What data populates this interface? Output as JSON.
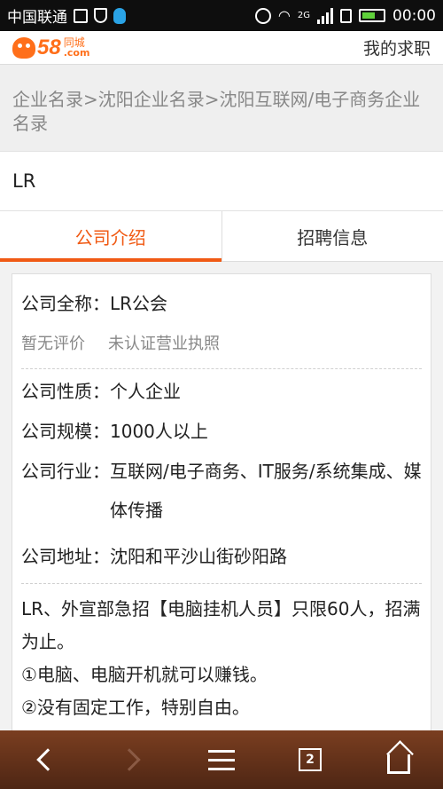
{
  "status_bar": {
    "carrier": "中国联通",
    "network": "2G",
    "time": "00:00"
  },
  "header": {
    "logo_number": "58",
    "logo_cn": "同城",
    "logo_domain": ".com",
    "my_job_label": "我的求职"
  },
  "breadcrumb": {
    "text": "企业名录>沈阳企业名录>沈阳互联网/电子商务企业名录"
  },
  "company": {
    "short_name": "LR"
  },
  "tabs": [
    {
      "label": "公司介绍",
      "active": true
    },
    {
      "label": "招聘信息",
      "active": false
    }
  ],
  "profile": {
    "fullname_key": "公司全称：",
    "fullname_value": "LR公会",
    "rating": "暂无评价",
    "license": "未认证营业执照",
    "nature_key": "公司性质：",
    "nature_value": "个人企业",
    "scale_key": "公司规模：",
    "scale_value": "1000人以上",
    "industry_key": "公司行业：",
    "industry_value": "互联网/电子商务、IT服务/系统集成、媒体传播",
    "address_key": "公司地址：",
    "address_value": "沈阳和平沙山街砂阳路"
  },
  "description": [
    "LR、外宣部急招【电脑挂机人员】只限60人，招满为止。",
    "①电脑、电脑开机就可以赚钱。",
    "②没有固定工作，特别自由。"
  ],
  "bottom_nav": {
    "tab_count": "2"
  },
  "colors": {
    "accent": "#f05a14",
    "brand": "#ff6f1a"
  }
}
